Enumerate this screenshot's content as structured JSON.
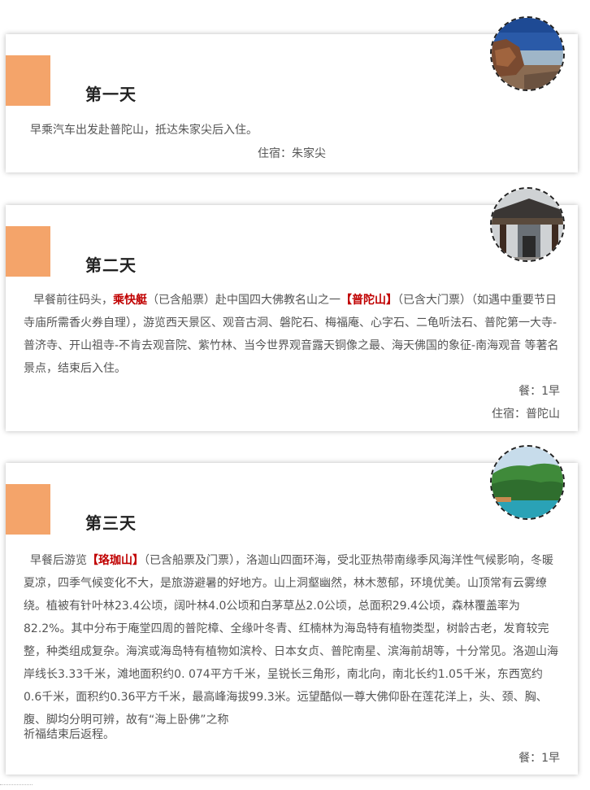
{
  "days": [
    {
      "title": "第一天",
      "text": "早乘汽车出发赴普陀山，抵达朱家尖后入住。",
      "lodging": "住宿：朱家尖",
      "photo": "rocky-coast-photo"
    },
    {
      "title": "第二天",
      "segments": [
        "早餐前往码头，",
        "乘快艇",
        "（已含船票）赴中国四大佛教名山之一",
        "【普陀山】",
        "（已含大门票）（如遇中重要节日寺庙所需香火券自理），游览西天景区、观音古洞、磐陀石、梅福庵、心字石、二龟听法石、普陀第一大寺-普济寺、开山祖寺-不肯去观音院、紫竹林、当今世界观音露天铜像之最、海天佛国的象征-南海观音 等著名景点，结束后入住。"
      ],
      "meals": "餐：1早",
      "lodging": "住宿：普陀山",
      "photo": "temple-gate-photo"
    },
    {
      "title": "第三天",
      "segments": [
        "早餐后游览",
        "【珞珈山】",
        "（已含船票及门票），洛迦山四面环海，受北亚热带南缘季风海洋性气候影响，冬暖夏凉，四季气候变化不大，是旅游避暑的好地方。山上洞壑幽然，林木葱郁，环境优美。山顶常有云雾缭绕。植被有针叶林23.4公顷，阔叶林4.0公顷和白茅草丛2.0公顷，总面积29.4公顷，森林覆盖率为82.2%。其中分布于庵堂四周的普陀樟、全缘叶冬青、红楠林为海岛特有植物类型，树龄古老，发育较完整，种类组成复杂。海滨或海岛特有植物如滨柃、日本女贞、普陀南星、滨海前胡等，十分常见。洛迦山海岸线长3.33千米，滩地面积约0. 074平方千米，呈锐长三角形，南北向，南北长约1.05千米，东西宽约0.6千米，面积约0.36平方千米，最高峰海拔99.3米。远望酷似一尊大佛仰卧在莲花洋上，头、颈、胸、腹、脚均分明可辨，故有“海上卧佛”之称"
      ],
      "extra": "祈福结束后返程。",
      "meals": "餐：1早",
      "photo": "green-island-photo"
    }
  ]
}
